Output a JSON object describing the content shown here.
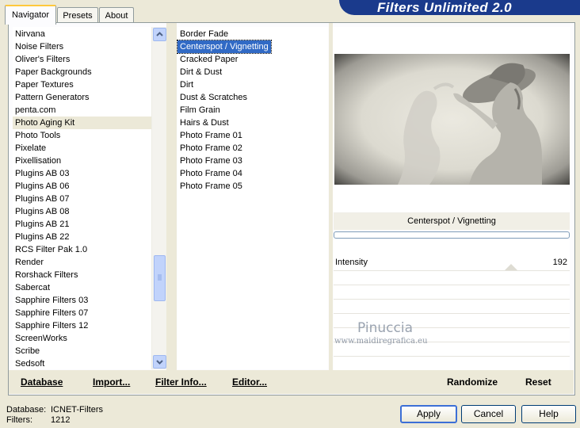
{
  "app": {
    "title": "Filters Unlimited 2.0"
  },
  "tabs": [
    {
      "label": "Navigator"
    },
    {
      "label": "Presets"
    },
    {
      "label": "About"
    }
  ],
  "categories": [
    "Nirvana",
    "Noise Filters",
    "Oliver's Filters",
    "Paper Backgrounds",
    "Paper Textures",
    "Pattern Generators",
    "penta.com",
    "Photo Aging Kit",
    "Photo Tools",
    "Pixelate",
    "Pixellisation",
    "Plugins AB 03",
    "Plugins AB 06",
    "Plugins AB 07",
    "Plugins AB 08",
    "Plugins AB 21",
    "Plugins AB 22",
    "RCS Filter Pak 1.0",
    "Render",
    "Rorshack Filters",
    "Sabercat",
    "Sapphire Filters 03",
    "Sapphire Filters 07",
    "Sapphire Filters 12",
    "ScreenWorks",
    "Scribe",
    "Sedsoft"
  ],
  "selected_category": "Photo Aging Kit",
  "filters": [
    "Border Fade",
    "Centerspot / Vignetting",
    "Cracked Paper",
    "Dirt & Dust",
    "Dirt",
    "Dust & Scratches",
    "Film Grain",
    "Hairs & Dust",
    "Photo Frame 01",
    "Photo Frame 02",
    "Photo Frame 03",
    "Photo Frame 04",
    "Photo Frame 05"
  ],
  "selected_filter": "Centerspot / Vignetting",
  "filter_panel": {
    "title": "Centerspot / Vignetting",
    "params": [
      {
        "label": "Intensity",
        "value": "192"
      }
    ]
  },
  "watermark": {
    "name": "Pinuccia",
    "url": "www.maidiregrafica.eu"
  },
  "bottom_buttons": {
    "database": "Database",
    "import": "Import...",
    "filter_info": "Filter Info...",
    "editor": "Editor...",
    "randomize": "Randomize",
    "reset": "Reset"
  },
  "status": {
    "database_label": "Database:",
    "database_value": "ICNET-Filters",
    "filters_label": "Filters:",
    "filters_value": "1212"
  },
  "dialog_buttons": {
    "apply": "Apply",
    "cancel": "Cancel",
    "help": "Help"
  },
  "colors": {
    "banner": "#1a3a8c",
    "selection": "#316ac5",
    "face": "#ece9d8"
  },
  "icons": {
    "scroll_up": "chevron-up-icon",
    "scroll_down": "chevron-down-icon"
  }
}
